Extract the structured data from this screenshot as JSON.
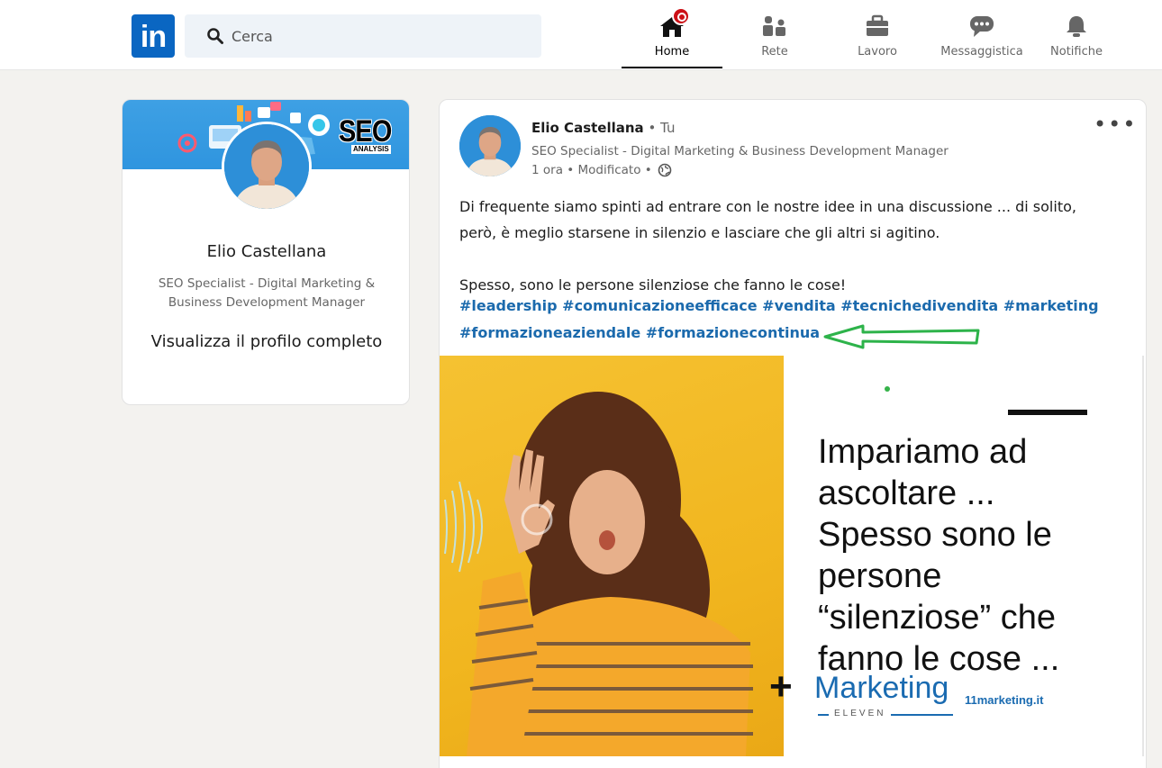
{
  "nav": {
    "search_placeholder": "Cerca",
    "items": [
      {
        "label": "Home",
        "icon": "home-icon",
        "active": true
      },
      {
        "label": "Rete",
        "icon": "network-icon",
        "active": false
      },
      {
        "label": "Lavoro",
        "icon": "briefcase-icon",
        "active": false
      },
      {
        "label": "Messaggistica",
        "icon": "messaging-icon",
        "active": false
      },
      {
        "label": "Notifiche",
        "icon": "bell-icon",
        "active": false
      }
    ]
  },
  "profile": {
    "banner_title": "SEO",
    "banner_sub": "ANALYSIS",
    "name": "Elio Castellana",
    "headline": "SEO Specialist - Digital Marketing & Business Development Manager",
    "view_profile": "Visualizza il profilo completo"
  },
  "post": {
    "author": "Elio Castellana",
    "relation": " • Tu",
    "headline": "SEO Specialist - Digital Marketing & Business Development Manager",
    "time": "1 ora • Modificato • ",
    "text_line1": "Di frequente siamo spinti ad entrare con le nostre idee in una discussione ... di solito, però, è meglio starsene in silenzio e lasciare che gli altri si agitino.",
    "text_line2": "Spesso, sono le persone silenziose che fanno le cose!",
    "hashtags": "#leadership #comunicazioneefficace #vendita #tecnichedivendita #marketing #formazioneaziendale #formazionecontinua",
    "image": {
      "headline": [
        "Impariamo ad",
        "ascoltare ...",
        "Spesso sono le",
        "persone",
        "“silenziose” che",
        "fanno le cose ..."
      ],
      "plus": "+",
      "brand": "Marketing",
      "brand_sub": "ELEVEN",
      "brand_url": "11marketing.it"
    }
  },
  "colors": {
    "linkedin_blue": "#0a66c2",
    "hashtag": "#1b6aad",
    "arrow_green": "#2db34a",
    "notification_red": "#cc1016",
    "photo_yellow": "#f1b61f"
  }
}
